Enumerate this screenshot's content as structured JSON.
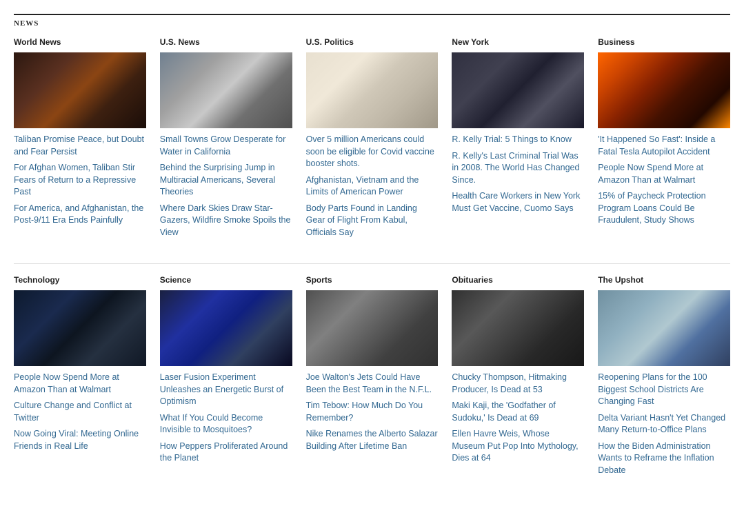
{
  "header": {
    "news_label": "NEWS"
  },
  "row1": {
    "columns": [
      {
        "id": "world-news",
        "title": "World News",
        "image_class": "img-world-news",
        "articles": [
          "Taliban Promise Peace, but Doubt and Fear Persist",
          "For Afghan Women, Taliban Stir Fears of Return to a Repressive Past",
          "For America, and Afghanistan, the Post-9/11 Era Ends Painfully"
        ]
      },
      {
        "id": "us-news",
        "title": "U.S. News",
        "image_class": "img-us-news",
        "articles": [
          "Small Towns Grow Desperate for Water in California",
          "Behind the Surprising Jump in Multiracial Americans, Several Theories",
          "Where Dark Skies Draw Star-Gazers, Wildfire Smoke Spoils the View"
        ]
      },
      {
        "id": "us-politics",
        "title": "U.S. Politics",
        "image_class": "img-us-politics",
        "articles": [
          "Over 5 million Americans could soon be eligible for Covid vaccine booster shots.",
          "Afghanistan, Vietnam and the Limits of American Power",
          "Body Parts Found in Landing Gear of Flight From Kabul, Officials Say"
        ]
      },
      {
        "id": "new-york",
        "title": "New York",
        "image_class": "img-new-york",
        "articles": [
          "R. Kelly Trial: 5 Things to Know",
          "R. Kelly's Last Criminal Trial Was in 2008. The World Has Changed Since.",
          "Health Care Workers in New York Must Get Vaccine, Cuomo Says"
        ]
      },
      {
        "id": "business",
        "title": "Business",
        "image_class": "img-business",
        "articles": [
          "'It Happened So Fast': Inside a Fatal Tesla Autopilot Accident",
          "People Now Spend More at Amazon Than at Walmart",
          "15% of Paycheck Protection Program Loans Could Be Fraudulent, Study Shows"
        ]
      }
    ]
  },
  "row2": {
    "columns": [
      {
        "id": "technology",
        "title": "Technology",
        "image_class": "img-technology",
        "articles": [
          "People Now Spend More at Amazon Than at Walmart",
          "Culture Change and Conflict at Twitter",
          "Now Going Viral: Meeting Online Friends in Real Life"
        ]
      },
      {
        "id": "science",
        "title": "Science",
        "image_class": "img-science",
        "articles": [
          "Laser Fusion Experiment Unleashes an Energetic Burst of Optimism",
          "What If You Could Become Invisible to Mosquitoes?",
          "How Peppers Proliferated Around the Planet"
        ]
      },
      {
        "id": "sports",
        "title": "Sports",
        "image_class": "img-sports",
        "articles": [
          "Joe Walton's Jets Could Have Been the Best Team in the N.F.L.",
          "Tim Tebow: How Much Do You Remember?",
          "Nike Renames the Alberto Salazar Building After Lifetime Ban"
        ]
      },
      {
        "id": "obituaries",
        "title": "Obituaries",
        "image_class": "img-obituaries",
        "articles": [
          "Chucky Thompson, Hitmaking Producer, Is Dead at 53",
          "Maki Kaji, the 'Godfather of Sudoku,' Is Dead at 69",
          "Ellen Havre Weis, Whose Museum Put Pop Into Mythology, Dies at 64"
        ]
      },
      {
        "id": "upshot",
        "title": "The Upshot",
        "image_class": "img-upshot",
        "articles": [
          "Reopening Plans for the 100 Biggest School Districts Are Changing Fast",
          "Delta Variant Hasn't Yet Changed Many Return-to-Office Plans",
          "How the Biden Administration Wants to Reframe the Inflation Debate"
        ]
      }
    ]
  }
}
